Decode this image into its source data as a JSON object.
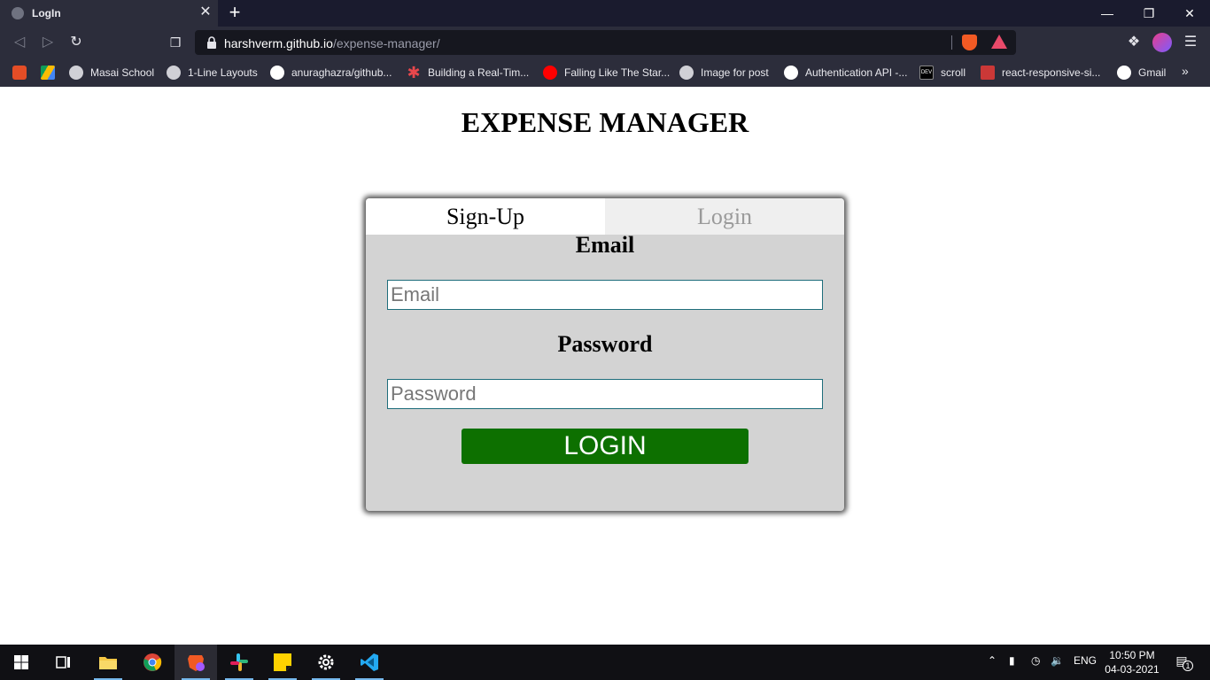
{
  "browser": {
    "tab_title": "LogIn",
    "tab_close": "✕",
    "new_tab": "+",
    "url_host": "harshverm.github.io",
    "url_path": "/expense-manager/",
    "bookmarks": [
      {
        "label": "",
        "icon": "brave-rewards-bookmark-icon",
        "color": "#e44d26"
      },
      {
        "label": "",
        "icon": "google-drive-icon",
        "color": "#fbbc04"
      },
      {
        "label": "Masai School",
        "icon": "globe-icon",
        "color": "#d0d0d6"
      },
      {
        "label": "1-Line Layouts",
        "icon": "globe-icon",
        "color": "#d0d0d6"
      },
      {
        "label": "anuraghazra/github...",
        "icon": "github-icon",
        "color": "#ffffff"
      },
      {
        "label": "Building a Real-Tim...",
        "icon": "asterisk-icon",
        "color": "#e8474c"
      },
      {
        "label": "Falling Like The Star...",
        "icon": "youtube-music-icon",
        "color": "#ff0000"
      },
      {
        "label": "Image for post",
        "icon": "globe-icon",
        "color": "#d0d0d6"
      },
      {
        "label": "Authentication API -...",
        "icon": "github-icon",
        "color": "#ffffff"
      },
      {
        "label": "scroll",
        "icon": "dev-icon",
        "color": "#000000"
      },
      {
        "label": "react-responsive-si...",
        "icon": "npm-icon",
        "color": "#cb3837"
      },
      {
        "label": "Gmail",
        "icon": "google-icon",
        "color": "#ffffff"
      }
    ],
    "bookmarks_more": "»"
  },
  "page": {
    "title": "EXPENSE MANAGER",
    "tabs": {
      "signup": "Sign-Up",
      "login": "Login"
    },
    "email_label": "Email",
    "email_placeholder": "Email",
    "password_label": "Password",
    "password_placeholder": "Password",
    "login_button": "LOGIN"
  },
  "colors": {
    "card_bg": "#d3d3d3",
    "login_button": "#0d7000",
    "input_border": "#1e6d7b"
  },
  "taskbar": {
    "apps": [
      "windows-start-icon",
      "task-view-icon",
      "file-explorer-icon",
      "chrome-icon",
      "brave-icon",
      "slack-icon",
      "sticky-notes-icon",
      "settings-icon",
      "vscode-icon"
    ],
    "language": "ENG",
    "time": "10:50 PM",
    "date": "04-03-2021",
    "notification_count": "1"
  }
}
